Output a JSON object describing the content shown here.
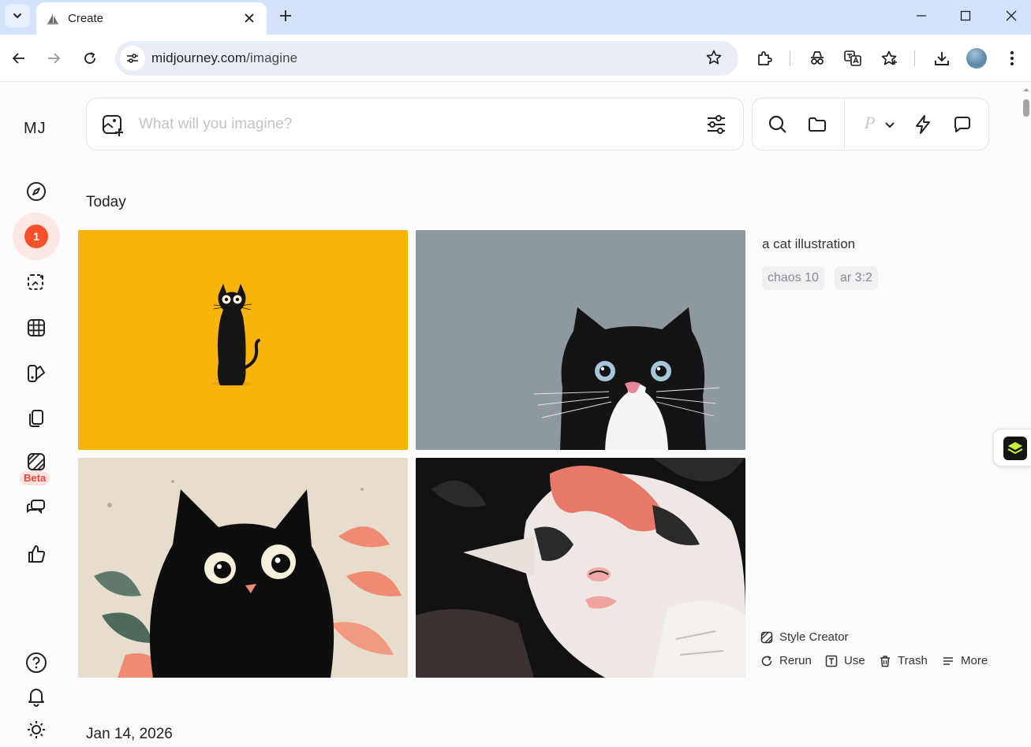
{
  "browser": {
    "tab_title": "Create",
    "url_domain": "midjourney.com",
    "url_path": "/imagine"
  },
  "app": {
    "logo": "MJ",
    "notifications_count": "1",
    "beta_label": "Beta",
    "prompt_placeholder": "What will you imagine?",
    "personalize_label": "P",
    "sections": {
      "today": "Today",
      "next_date": "Jan 14, 2026"
    },
    "job": {
      "prompt": "a cat illustration",
      "params": [
        "chaos 10",
        "ar 3:2"
      ],
      "actions": {
        "style_creator": "Style Creator",
        "rerun": "Rerun",
        "use": "Use",
        "trash": "Trash",
        "more": "More"
      }
    },
    "images": [
      {
        "alt": "black cat on yellow background"
      },
      {
        "alt": "black and white cat on grey background"
      },
      {
        "alt": "fluffy black cat with leaves"
      },
      {
        "alt": "calico cat lying down"
      }
    ]
  },
  "colors": {
    "accent": "#f4512c",
    "tabbar": "#d3e3fd",
    "beta_bg": "#fde2df"
  },
  "icons": [
    "search-icon",
    "folder-icon",
    "lightning-icon",
    "chat-icon",
    "sliders-icon",
    "image-add-icon",
    "compass-icon",
    "grid-icon",
    "help-icon",
    "bell-icon",
    "sun-icon"
  ]
}
